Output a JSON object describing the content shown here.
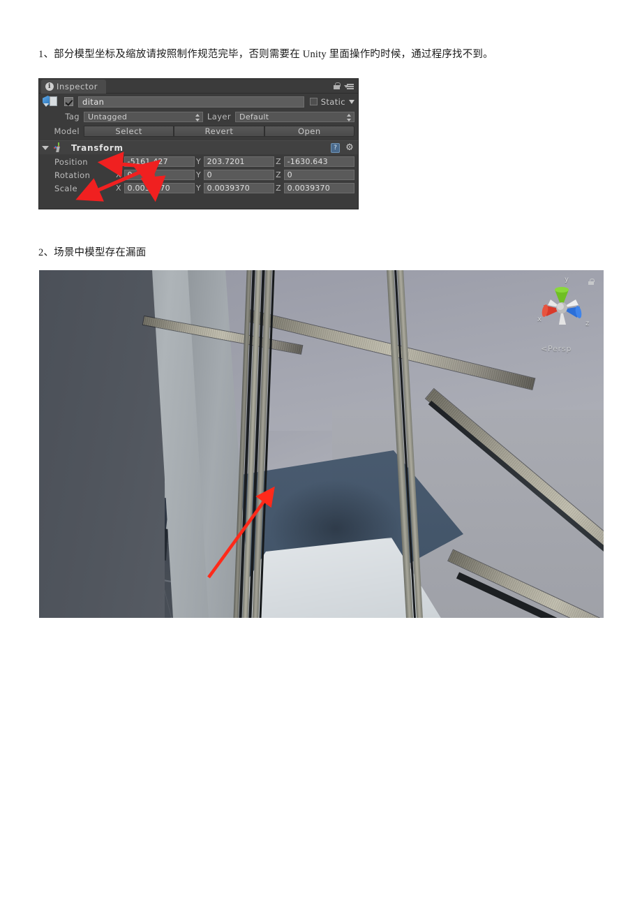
{
  "document": {
    "line1": "1、部分模型坐标及缩放请按照制作规范完毕，否则需要在 Unity 里面操作旳时候，通过程序找不到。",
    "line2": "2、场景中模型存在漏面"
  },
  "inspector": {
    "tab_label": "Inspector",
    "tab_icon": "info-icon",
    "lock_icon": "lock-icon",
    "menu_icon": "hamburger-menu-icon",
    "object": {
      "icon": "prefab-cube-icon",
      "enabled_checkbox": true,
      "name": "ditan",
      "static_label": "Static",
      "static_checked": false
    },
    "tag_row": {
      "tag_label": "Tag",
      "tag_value": "Untagged",
      "layer_label": "Layer",
      "layer_value": "Default"
    },
    "model_row": {
      "label": "Model",
      "buttons": [
        "Select",
        "Revert",
        "Open"
      ]
    },
    "transform": {
      "title": "Transform",
      "icon": "transform-axis-icon",
      "help_icon": "help-book-icon",
      "gear_icon": "gear-icon",
      "axes": [
        "X",
        "Y",
        "Z"
      ],
      "rows": [
        {
          "label": "Position",
          "x": "-5161.427",
          "y": "203.7201",
          "z": "-1630.643"
        },
        {
          "label": "Rotation",
          "x": "0",
          "y": "0",
          "z": "0"
        },
        {
          "label": "Scale",
          "x": "0.0039370",
          "y": "0.0039370",
          "z": "0.0039370"
        }
      ]
    },
    "annotation_color": "#f02020"
  },
  "scene": {
    "gizmo": {
      "x_label": "x",
      "y_label": "y",
      "z_label": "z",
      "x_color": "#d93a2b",
      "y_color": "#6fbf23",
      "z_color": "#2b6fd9",
      "lock_icon": "lock-icon"
    },
    "projection_label": "Persp",
    "annotation_color": "#ff2a1a"
  },
  "colors": {
    "inspector_bg": "#3b3b3b",
    "field_bg": "#5a5a5a",
    "viewport_bg": "#4e535a",
    "accent_red": "#f02020"
  }
}
